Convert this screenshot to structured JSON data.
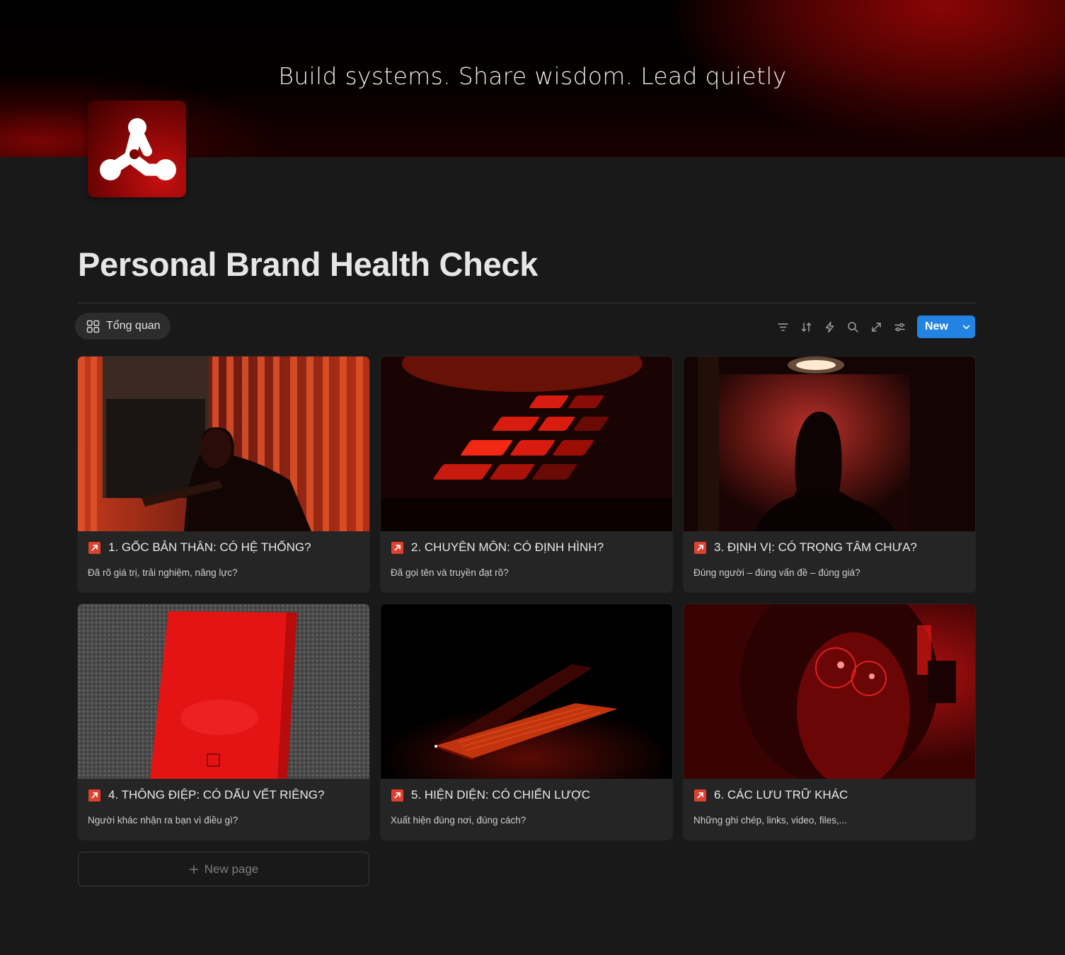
{
  "cover": {
    "tagline": "Build systems. Share wisdom. Lead quietly"
  },
  "page": {
    "title": "Personal Brand Health Check"
  },
  "view": {
    "tab_label": "Tổng quan",
    "tab_icon": "gallery-grid-icon"
  },
  "toolbar": {
    "icons": [
      "filter-icon",
      "sort-icon",
      "automation-bolt-icon",
      "search-icon",
      "expand-icon",
      "settings-sliders-icon"
    ],
    "new_label": "New"
  },
  "accent": {
    "new_button": "#2383e2",
    "link_icon": "#e0412e",
    "brand_red": "#c81010"
  },
  "cards": [
    {
      "title": "1. GỐC BẢN THÂN: CÓ HỆ THỐNG?",
      "desc": "Đã rõ giá trị, trải nghiệm, năng lực?",
      "image": "man with guitar by red-lit window blinds"
    },
    {
      "title": "2. CHUYÊN MÔN: CÓ ĐỊNH HÌNH?",
      "desc": "Đã gọi tên và truyền đạt rõ?",
      "image": "red glowing keyboard keys close-up"
    },
    {
      "title": "3. ĐỊNH VỊ: CÓ TRỌNG TÂM CHƯA?",
      "desc": "Đúng người – đúng vấn đề – đúng giá?",
      "image": "silhouetted figure under spotlight in red room"
    },
    {
      "title": "4. THÔNG ĐIỆP: CÓ DẤU VẾT RIÊNG?",
      "desc": "Người khác nhận ra bạn vì điều gì?",
      "image": "red notebook on grey carpet"
    },
    {
      "title": "5. HIỆN DIỆN: CÓ CHIẾN LƯỢC",
      "desc": "Xuất hiện đúng nơi, đúng cách?",
      "image": "half-open laptop glowing red in darkness"
    },
    {
      "title": "6. CÁC LƯU TRỮ KHÁC",
      "desc": "Những ghi chép, links, video, files,...",
      "image": "face with glasses in red light"
    }
  ],
  "new_page": {
    "label": "New page"
  }
}
